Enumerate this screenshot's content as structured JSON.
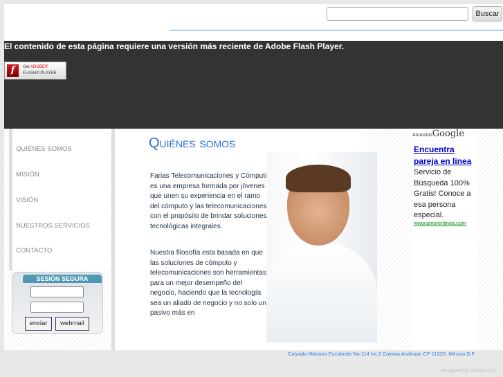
{
  "header": {
    "search_placeholder": "",
    "search_button": "Buscar"
  },
  "flash": {
    "message": "El contenido de esta página requiere una versión más reciente de Adobe Flash Player.",
    "badge_get": "Get",
    "badge_adobe": "ADOBE®",
    "badge_player": "FLASH® PLAYER"
  },
  "menu": [
    "QUIÉNES SOMOS",
    "MISIÓN",
    "VISIÓN",
    "NUESTROS SERVICIOS",
    "CONTACTO"
  ],
  "login": {
    "title": "SESIÓN SEGURA",
    "user_value": "",
    "pass_value": "",
    "submit": "enviar",
    "webmail": "webmail"
  },
  "main": {
    "title": "Quiénes somos",
    "paragraphs": [
      "Farias Telecomunicaciones y Cómputo es una empresa formada por jóvenes que unen su experiencia en el ramo del cómputo y las telecomunicaciones con el propósito de brindar soluciones tecnológicas integrales.",
      "Nuestra filosofía esta basada en que las soluciones de cómputo y telecomunicaciones son herramientas para un mejor desempeño del negocio, haciendo que la tecnología sea un aliado de negocio y no solo un pasivo más en"
    ]
  },
  "ads": {
    "label": "Anuncios",
    "brand": "Google",
    "title": "Encuentra pareja en linea",
    "text": "Servicio de Búsqueda 100% Gratis! Conoce a esa persona especial.",
    "url": "www.amorenlinea.com"
  },
  "footer": {
    "address": "Calzada Mariano Escobedo No.114 Int.3 Colonia Anáhuac CP 11320. México D.F.",
    "designed_by": "designed by Victor's Co."
  }
}
